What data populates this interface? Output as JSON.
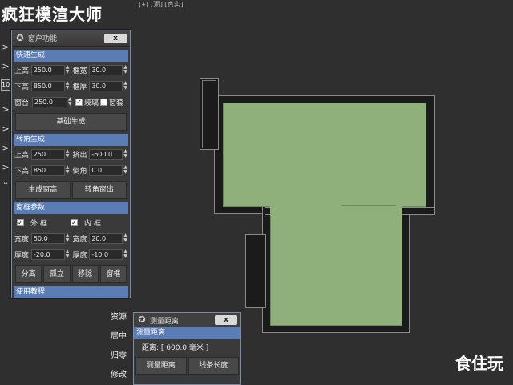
{
  "app": {
    "title": "疯狂模渲大师",
    "watermark": "食住玩",
    "viewport_label": "[+][顶][真实]"
  },
  "left_rail": {
    "arrow": ">",
    "box_text": "10"
  },
  "window_panel": {
    "title": "窗户功能",
    "close_label": "x",
    "quick": {
      "header": "快速生成",
      "rows": [
        {
          "l1": "上高",
          "v1": "250.0",
          "l2": "框宽",
          "v2": "30.0"
        },
        {
          "l1": "下高",
          "v1": "850.0",
          "l2": "框厚",
          "v2": "30.0"
        }
      ],
      "sill_label": "窗台",
      "sill_value": "250.0",
      "glass_label": "玻璃",
      "glass_checked": true,
      "cover_label": "窗套",
      "cover_checked": false,
      "button": "基础生成"
    },
    "corner": {
      "header": "转角生成",
      "rows": [
        {
          "l1": "上高",
          "v1": "250",
          "l2": "挤出",
          "v2": "-600.0"
        },
        {
          "l1": "下高",
          "v1": "850",
          "l2": "倒角",
          "v2": "0.0"
        }
      ],
      "buttons": [
        "生成窗高",
        "转角窗出"
      ]
    },
    "frame": {
      "header": "窗框参数",
      "outer_label": "外 框",
      "inner_label": "内 框",
      "outer_checked": true,
      "inner_checked": true,
      "rows": [
        {
          "l1": "宽度",
          "v1": "50.0",
          "l2": "宽度",
          "v2": "20.0"
        },
        {
          "l1": "厚度",
          "v1": "-20.0",
          "l2": "厚度",
          "v2": "-10.0"
        }
      ],
      "buttons": [
        "分离",
        "孤立",
        "移除",
        "窗框"
      ]
    },
    "tutorial": {
      "header": "使用教程"
    }
  },
  "side_menu": [
    "资源",
    "居中",
    "归零",
    "修改"
  ],
  "measure_panel": {
    "title": "测量距离",
    "close_label": "x",
    "header": "测量距离",
    "distance_text": "距离: [ 600.0 毫米 ]",
    "buttons": [
      "测量距离",
      "线条长度"
    ]
  }
}
